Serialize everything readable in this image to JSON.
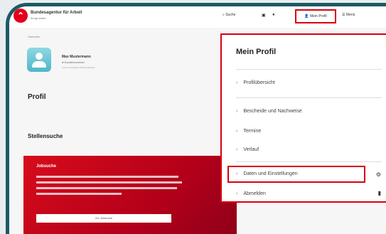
{
  "topbar": {
    "brand": "Bundesagentur für Arbeit",
    "brand_sub": "bringt weiter",
    "search_label": "Suche",
    "profile_label": "Mein Profil",
    "menu_label": "Menü"
  },
  "breadcrumb": "Startseite",
  "user": {
    "name": "Max Mustermann",
    "line1": "● Kundennummer",
    "line2": "Letzte Anmeldung     Profil bearbeiten"
  },
  "headings": {
    "profil": "Profil",
    "stellensuche": "Stellensuche"
  },
  "job_card": {
    "title": "Jobsuche",
    "button": "Zur Jobsuche"
  },
  "dropdown": {
    "title": "Mein Profil",
    "items": [
      {
        "label": "Profilübersicht"
      },
      {
        "label": "Bescheide und Nachweise"
      },
      {
        "label": "Termine"
      },
      {
        "label": "Verlauf"
      },
      {
        "label": "Daten und Einstellungen"
      },
      {
        "label": "Abmelden"
      }
    ]
  },
  "colors": {
    "accent": "#d8000f",
    "frame": "#1c5a66"
  },
  "icons": [
    "search-icon",
    "chat-icon",
    "bell-icon",
    "user-icon",
    "menu-icon",
    "gear-icon",
    "logout-icon"
  ]
}
